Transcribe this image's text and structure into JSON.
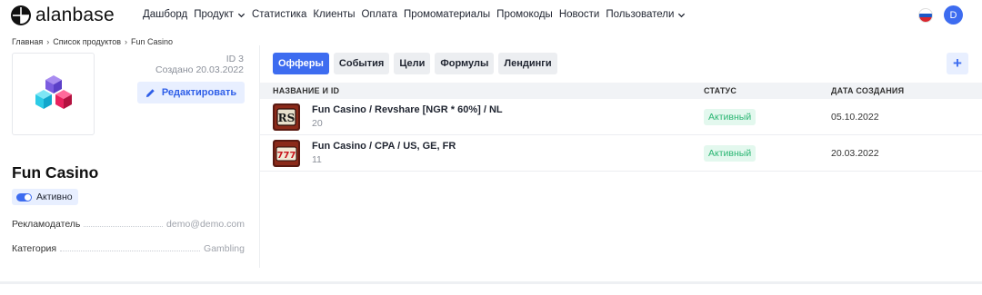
{
  "brand": {
    "name": "alanbase"
  },
  "nav": {
    "items": [
      {
        "label": "Дашборд",
        "dropdown": false
      },
      {
        "label": "Продукт",
        "dropdown": true
      },
      {
        "label": "Статистика",
        "dropdown": false
      },
      {
        "label": "Клиенты",
        "dropdown": false
      },
      {
        "label": "Оплата",
        "dropdown": false
      },
      {
        "label": "Промоматериалы",
        "dropdown": false
      },
      {
        "label": "Промокоды",
        "dropdown": false
      },
      {
        "label": "Новости",
        "dropdown": false
      },
      {
        "label": "Пользователи",
        "dropdown": true
      }
    ],
    "language_flag": "ru-flag-icon",
    "user_initial": "D"
  },
  "breadcrumb": [
    "Главная",
    "Список продуктов",
    "Fun Casino"
  ],
  "product": {
    "id_text": "ID 3",
    "created_text": "Создано 20.03.2022",
    "edit_label": "Редактировать",
    "title": "Fun Casino",
    "status_label": "Активно",
    "advertiser_label": "Рекламодатель",
    "advertiser_value": "demo@demo.com",
    "category_label": "Категория",
    "category_value": "Gambling"
  },
  "tabs": [
    {
      "label": "Офферы",
      "active": true
    },
    {
      "label": "События",
      "active": false
    },
    {
      "label": "Цели",
      "active": false
    },
    {
      "label": "Формулы",
      "active": false
    },
    {
      "label": "Лендинги",
      "active": false
    }
  ],
  "add_button": "+",
  "table": {
    "headers": {
      "name": "НАЗВАНИЕ И ID",
      "status": "СТАТУС",
      "date": "ДАТА СОЗДАНИЯ"
    },
    "rows": [
      {
        "name": "Fun Casino / Revshare [NGR * 60%] / NL",
        "id": "20",
        "status": "Активный",
        "date": "05.10.2022",
        "icon": "rs-slot-icon"
      },
      {
        "name": "Fun Casino / CPA / US, GE, FR",
        "id": "11",
        "status": "Активный",
        "date": "20.03.2022",
        "icon": "777-slot-icon"
      }
    ]
  },
  "colors": {
    "accent": "#3d6cf0",
    "accent_light": "#e8efff",
    "success": "#2bb673",
    "success_bg": "#e3f8ee"
  }
}
